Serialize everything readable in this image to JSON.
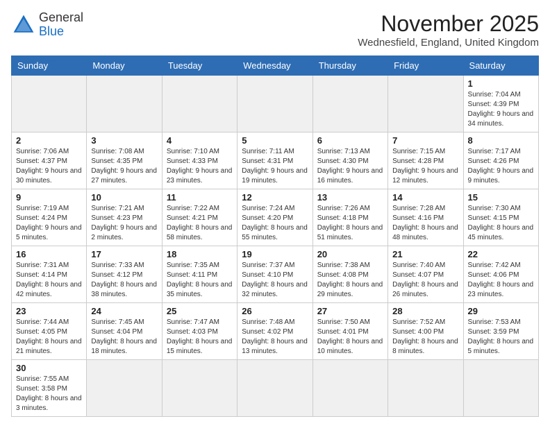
{
  "logo": {
    "line1": "General",
    "line2": "Blue"
  },
  "title": "November 2025",
  "subtitle": "Wednesfield, England, United Kingdom",
  "weekdays": [
    "Sunday",
    "Monday",
    "Tuesday",
    "Wednesday",
    "Thursday",
    "Friday",
    "Saturday"
  ],
  "weeks": [
    [
      {
        "day": "",
        "info": ""
      },
      {
        "day": "",
        "info": ""
      },
      {
        "day": "",
        "info": ""
      },
      {
        "day": "",
        "info": ""
      },
      {
        "day": "",
        "info": ""
      },
      {
        "day": "",
        "info": ""
      },
      {
        "day": "1",
        "info": "Sunrise: 7:04 AM\nSunset: 4:39 PM\nDaylight: 9 hours\nand 34 minutes."
      }
    ],
    [
      {
        "day": "2",
        "info": "Sunrise: 7:06 AM\nSunset: 4:37 PM\nDaylight: 9 hours\nand 30 minutes."
      },
      {
        "day": "3",
        "info": "Sunrise: 7:08 AM\nSunset: 4:35 PM\nDaylight: 9 hours\nand 27 minutes."
      },
      {
        "day": "4",
        "info": "Sunrise: 7:10 AM\nSunset: 4:33 PM\nDaylight: 9 hours\nand 23 minutes."
      },
      {
        "day": "5",
        "info": "Sunrise: 7:11 AM\nSunset: 4:31 PM\nDaylight: 9 hours\nand 19 minutes."
      },
      {
        "day": "6",
        "info": "Sunrise: 7:13 AM\nSunset: 4:30 PM\nDaylight: 9 hours\nand 16 minutes."
      },
      {
        "day": "7",
        "info": "Sunrise: 7:15 AM\nSunset: 4:28 PM\nDaylight: 9 hours\nand 12 minutes."
      },
      {
        "day": "8",
        "info": "Sunrise: 7:17 AM\nSunset: 4:26 PM\nDaylight: 9 hours\nand 9 minutes."
      }
    ],
    [
      {
        "day": "9",
        "info": "Sunrise: 7:19 AM\nSunset: 4:24 PM\nDaylight: 9 hours\nand 5 minutes."
      },
      {
        "day": "10",
        "info": "Sunrise: 7:21 AM\nSunset: 4:23 PM\nDaylight: 9 hours\nand 2 minutes."
      },
      {
        "day": "11",
        "info": "Sunrise: 7:22 AM\nSunset: 4:21 PM\nDaylight: 8 hours\nand 58 minutes."
      },
      {
        "day": "12",
        "info": "Sunrise: 7:24 AM\nSunset: 4:20 PM\nDaylight: 8 hours\nand 55 minutes."
      },
      {
        "day": "13",
        "info": "Sunrise: 7:26 AM\nSunset: 4:18 PM\nDaylight: 8 hours\nand 51 minutes."
      },
      {
        "day": "14",
        "info": "Sunrise: 7:28 AM\nSunset: 4:16 PM\nDaylight: 8 hours\nand 48 minutes."
      },
      {
        "day": "15",
        "info": "Sunrise: 7:30 AM\nSunset: 4:15 PM\nDaylight: 8 hours\nand 45 minutes."
      }
    ],
    [
      {
        "day": "16",
        "info": "Sunrise: 7:31 AM\nSunset: 4:14 PM\nDaylight: 8 hours\nand 42 minutes."
      },
      {
        "day": "17",
        "info": "Sunrise: 7:33 AM\nSunset: 4:12 PM\nDaylight: 8 hours\nand 38 minutes."
      },
      {
        "day": "18",
        "info": "Sunrise: 7:35 AM\nSunset: 4:11 PM\nDaylight: 8 hours\nand 35 minutes."
      },
      {
        "day": "19",
        "info": "Sunrise: 7:37 AM\nSunset: 4:10 PM\nDaylight: 8 hours\nand 32 minutes."
      },
      {
        "day": "20",
        "info": "Sunrise: 7:38 AM\nSunset: 4:08 PM\nDaylight: 8 hours\nand 29 minutes."
      },
      {
        "day": "21",
        "info": "Sunrise: 7:40 AM\nSunset: 4:07 PM\nDaylight: 8 hours\nand 26 minutes."
      },
      {
        "day": "22",
        "info": "Sunrise: 7:42 AM\nSunset: 4:06 PM\nDaylight: 8 hours\nand 23 minutes."
      }
    ],
    [
      {
        "day": "23",
        "info": "Sunrise: 7:44 AM\nSunset: 4:05 PM\nDaylight: 8 hours\nand 21 minutes."
      },
      {
        "day": "24",
        "info": "Sunrise: 7:45 AM\nSunset: 4:04 PM\nDaylight: 8 hours\nand 18 minutes."
      },
      {
        "day": "25",
        "info": "Sunrise: 7:47 AM\nSunset: 4:03 PM\nDaylight: 8 hours\nand 15 minutes."
      },
      {
        "day": "26",
        "info": "Sunrise: 7:48 AM\nSunset: 4:02 PM\nDaylight: 8 hours\nand 13 minutes."
      },
      {
        "day": "27",
        "info": "Sunrise: 7:50 AM\nSunset: 4:01 PM\nDaylight: 8 hours\nand 10 minutes."
      },
      {
        "day": "28",
        "info": "Sunrise: 7:52 AM\nSunset: 4:00 PM\nDaylight: 8 hours\nand 8 minutes."
      },
      {
        "day": "29",
        "info": "Sunrise: 7:53 AM\nSunset: 3:59 PM\nDaylight: 8 hours\nand 5 minutes."
      }
    ],
    [
      {
        "day": "30",
        "info": "Sunrise: 7:55 AM\nSunset: 3:58 PM\nDaylight: 8 hours\nand 3 minutes."
      },
      {
        "day": "",
        "info": ""
      },
      {
        "day": "",
        "info": ""
      },
      {
        "day": "",
        "info": ""
      },
      {
        "day": "",
        "info": ""
      },
      {
        "day": "",
        "info": ""
      },
      {
        "day": "",
        "info": ""
      }
    ]
  ]
}
